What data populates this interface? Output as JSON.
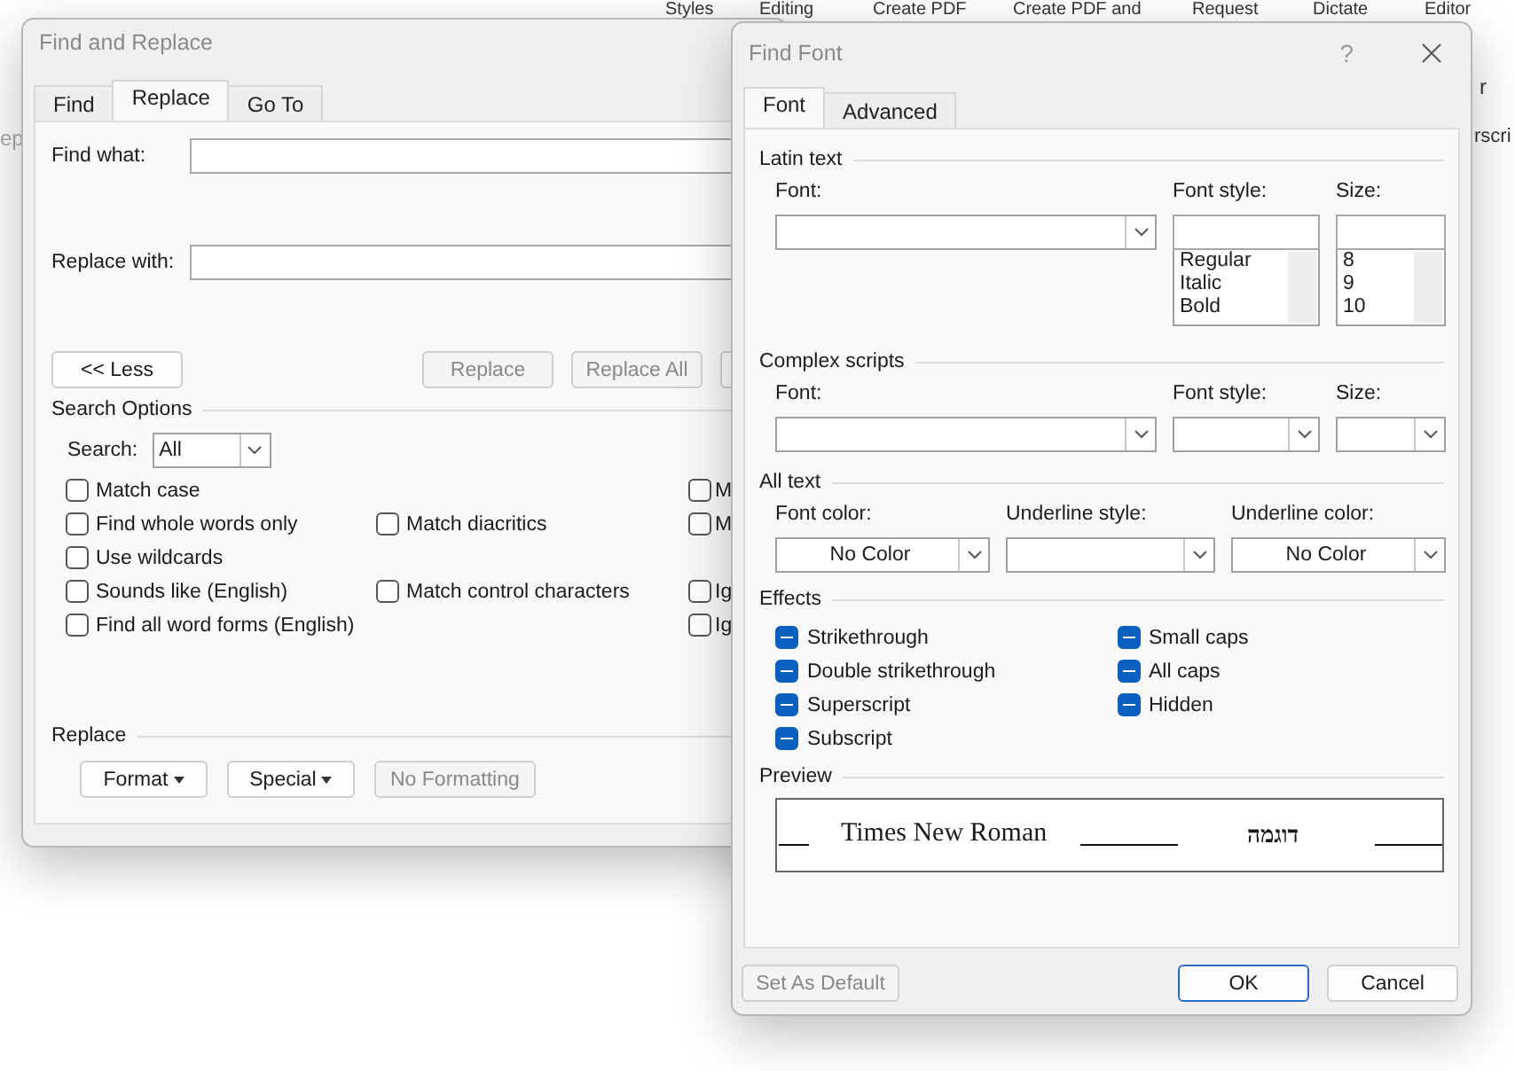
{
  "background": {
    "ribbon_labels": [
      "Styles",
      "Editing",
      "Create PDF",
      "Create PDF and",
      "Request",
      "Dictate",
      "Editor"
    ],
    "side_fragments": [
      "r",
      "rscri"
    ],
    "left_fragment": "ep"
  },
  "find_replace": {
    "title": "Find and Replace",
    "tabs": [
      {
        "label": "Find",
        "selected": false
      },
      {
        "label": "Replace",
        "selected": true
      },
      {
        "label": "Go To",
        "selected": false
      }
    ],
    "find_label": "Find what:",
    "replace_label": "Replace with:",
    "buttons": [
      {
        "label": "<< Less",
        "disabled": false
      },
      {
        "label": "Replace",
        "disabled": true
      },
      {
        "label": "Replace All",
        "disabled": true
      }
    ],
    "search_options_title": "Search Options",
    "search_label": "Search:",
    "search_value": "All",
    "option_rows": [
      [
        {
          "label": "Match case",
          "checked": false
        },
        null,
        {
          "label": "M",
          "checked": false
        }
      ],
      [
        {
          "label": "Find whole words only",
          "checked": false
        },
        {
          "label": "Match diacritics",
          "checked": false
        },
        {
          "label": "M",
          "checked": false
        }
      ],
      [
        {
          "label": "Use wildcards",
          "checked": false
        },
        null,
        null
      ],
      [
        {
          "label": "Sounds like (English)",
          "checked": false
        },
        {
          "label": "Match control characters",
          "checked": false
        },
        {
          "label": "Ig",
          "checked": false
        }
      ],
      [
        {
          "label": "Find all word forms (English)",
          "checked": false
        },
        null,
        {
          "label": "Ig",
          "checked": false
        }
      ]
    ],
    "replace_title": "Replace",
    "replace_buttons": [
      {
        "label": "Format",
        "dropdown": true,
        "disabled": false
      },
      {
        "label": "Special",
        "dropdown": true,
        "disabled": false
      },
      {
        "label": "No Formatting",
        "dropdown": false,
        "disabled": true
      }
    ]
  },
  "find_font": {
    "title": "Find Font",
    "help": "?",
    "tabs": [
      {
        "label": "Font",
        "selected": true
      },
      {
        "label": "Advanced",
        "selected": false
      }
    ],
    "latin_title": "Latin text",
    "font_label": "Font:",
    "style_label": "Font style:",
    "size_label": "Size:",
    "style_list": [
      "Regular",
      "Italic",
      "Bold"
    ],
    "size_list": [
      "8",
      "9",
      "10"
    ],
    "complex_title": "Complex scripts",
    "complex_font_label": "Font:",
    "complex_style_label": "Font style:",
    "complex_size_label": "Size:",
    "all_text_title": "All text",
    "combos": [
      {
        "label": "Font color:",
        "value": "No Color"
      },
      {
        "label": "Underline style:"
      },
      {
        "label": "Underline color:",
        "value": "No Color"
      }
    ],
    "effects_title": "Effects",
    "effects_left": [
      {
        "label": "Strikethrough",
        "indeterminate": true
      },
      {
        "label": "Double strikethrough",
        "indeterminate": true
      },
      {
        "label": "Superscript",
        "indeterminate": true
      },
      {
        "label": "Subscript",
        "indeterminate": true
      }
    ],
    "effects_right": [
      {
        "label": "Small caps",
        "indeterminate": true
      },
      {
        "label": "All caps",
        "indeterminate": true
      },
      {
        "label": "Hidden",
        "indeterminate": true
      }
    ],
    "preview_title": "Preview",
    "preview_latin": "Times New Roman",
    "preview_complex": "דוגמה",
    "buttons": [
      {
        "label": "Set As Default",
        "disabled": true,
        "default": false
      },
      {
        "label": "OK",
        "disabled": false,
        "default": true
      },
      {
        "label": "Cancel",
        "disabled": false,
        "default": false
      }
    ]
  }
}
